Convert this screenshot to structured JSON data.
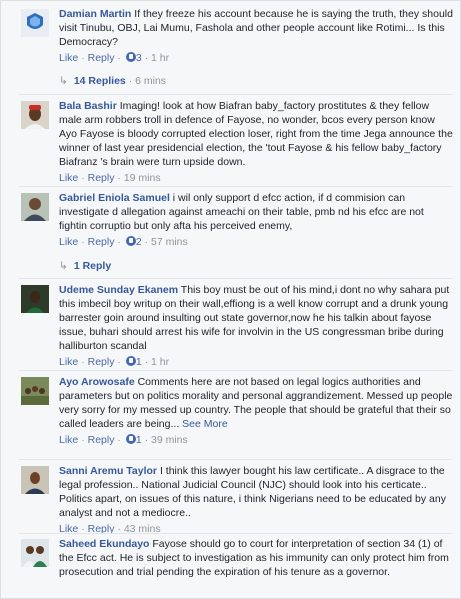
{
  "comments": [
    {
      "author": "Damian Martin",
      "text": "If they freeze his account because he is saying the truth, they should visit Tinubu, OBJ, Lai Mumu, Fashola and other people account like Rotimi... Is this Democracy?",
      "like": "Like",
      "reply": "Reply",
      "likes": "3",
      "time": "1 hr",
      "avatar": "blue-shield-icon"
    },
    {
      "author": "Bala Bashir",
      "text": "Imaging! look at how Biafran baby_factory prostitutes & they fellow male arm robbers troll in defence of Fayose, no wonder, bcos every person know Ayo Fayose is bloody corrupted election loser, right from the time Jega announce the winner of last year presidencial election, the 'tout Fayose & his fellow baby_factory Biafranz 's brain were turn upside down.",
      "like": "Like",
      "reply": "Reply",
      "time": "19 mins",
      "avatar": "man-red-cap-icon"
    },
    {
      "author": "Gabriel Eniola Samuel",
      "text": "i wil only support d efcc action, if d commision can investigate d allegation against ameachi on their table, pmb nd his efcc are not fightin corruptio but only afta his perceived enemy,",
      "like": "Like",
      "reply": "Reply",
      "likes": "2",
      "time": "57 mins",
      "avatar": "portrait-icon"
    },
    {
      "author": "Udeme Sunday Ekanem",
      "text": "This boy must be out of his mind,i dont no why sahara put this imbecil boy writup on their wall,effiong is a well know corrupt and a drunk young barrester goin around insulting out state governor,now he his talkin about fayose issue, buhari should arrest his wife for involvin in the US congressman bribe during halliburton scandal",
      "like": "Like",
      "reply": "Reply",
      "likes": "1",
      "time": "1 hr",
      "avatar": "man-portrait-icon"
    },
    {
      "author": "Ayo Arowosafe",
      "text": "Comments here are not based on legal logics authorities and parameters but on politics morality and personal aggrandizement. Messed up people very sorry for my messed up country. The people that should be grateful that their so called leaders are being...",
      "see_more": "See More",
      "like": "Like",
      "reply": "Reply",
      "likes": "1",
      "time": "39 mins",
      "avatar": "crowd-photo-icon"
    },
    {
      "author": "Sanni Aremu Taylor",
      "text": "I think this lawyer bought his law certificate.. A disgrace to the legal profession.. National Judicial Council (NJC) should look into his certicate.. Politics apart, on issues of this nature, i think Nigerians need to be educated by any analyst and not a mediocre..",
      "like": "Like",
      "reply": "Reply",
      "time": "43 mins",
      "avatar": "man-portrait-icon"
    },
    {
      "author": "Saheed Ekundayo",
      "text": "Fayose should go to court for interpretation of section 34 (1) of the Efcc act. He is subject to investigation as his immunity can only protect him from prosecution and trial pending the expiration of his tenure as a governor.",
      "avatar": "two-people-icon"
    }
  ],
  "replies_1": {
    "label": "14 Replies",
    "time": "6 mins"
  },
  "replies_3": {
    "label": "1 Reply"
  },
  "separator": "·"
}
